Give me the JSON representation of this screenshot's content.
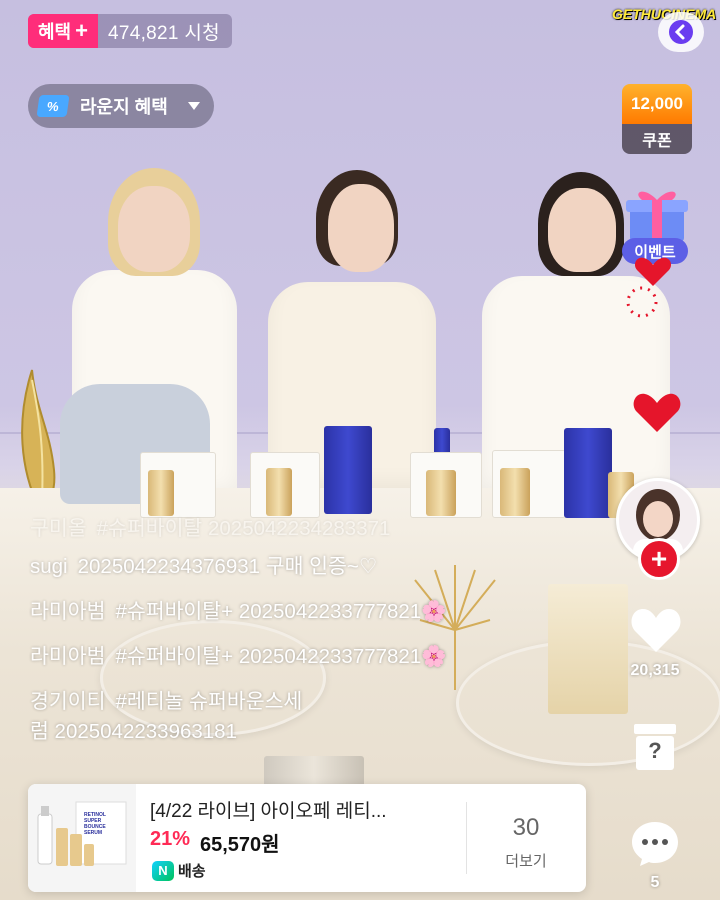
{
  "top_bar": {
    "benefit_label": "혜택",
    "benefit_plus": "+",
    "viewers": "474,821 시청"
  },
  "watermark": "GETHUCINEMA",
  "lounge": {
    "icon": "%",
    "label": "라운지 혜택"
  },
  "coupon": {
    "amount": "12,000",
    "label": "쿠폰"
  },
  "event": {
    "label": "이벤트",
    "icon": "gift-icon"
  },
  "chat": [
    {
      "nick": "구미올",
      "text": "#슈퍼바이탈 2025042234283371",
      "faded": true
    },
    {
      "nick": "sugi",
      "text": "2025042234376931 구매 인증~♡"
    },
    {
      "nick": "라미아범",
      "text": "#슈퍼바이탈+ 2025042233777821",
      "flower": "🌸"
    },
    {
      "nick": "라미아범",
      "text": "#슈퍼바이탈+ 2025042233777821",
      "flower": "🌸"
    },
    {
      "nick": "경기이티",
      "text": "#레티놀 슈퍼바운스세",
      "text2": "럼 2025042233963181"
    }
  ],
  "side": {
    "likes": "20,315",
    "comments": "5",
    "mystery": "?"
  },
  "product": {
    "title": "[4/22 라이브] 아이오페 레티...",
    "discount": "21%",
    "price": "65,570원",
    "shipping": "배송",
    "npay": "N",
    "more_count": "30",
    "more_label": "더보기",
    "thumb_text": "RETINOL SUPER BOUNCE SERUM"
  },
  "colors": {
    "accent_pink": "#ff2d7a",
    "coupon_orange": "#ff8a00",
    "event_blue": "#5c5fe6",
    "like_red": "#e6162d"
  }
}
